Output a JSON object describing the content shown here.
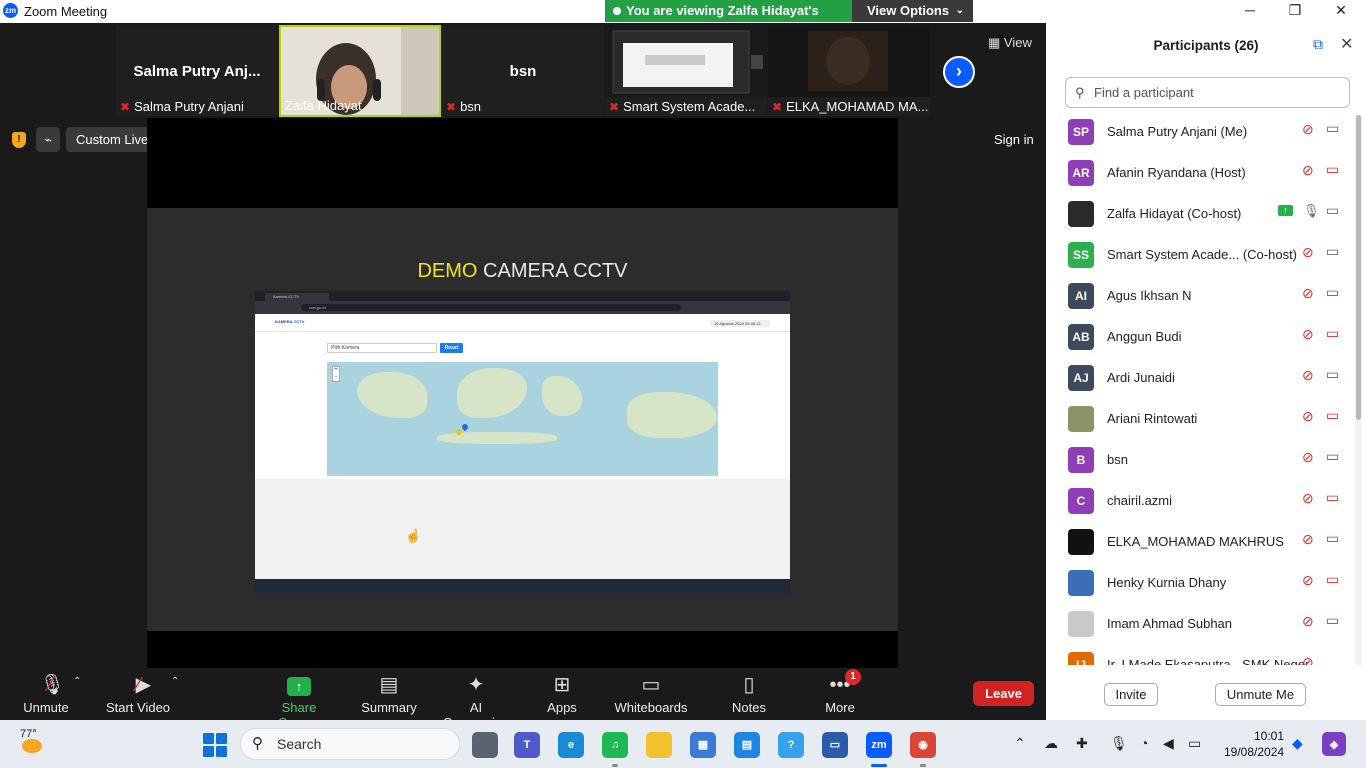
{
  "window": {
    "app_title": "Zoom Meeting",
    "logo": "zm",
    "minimize": "─",
    "maximize": "❐",
    "close": "✕"
  },
  "share_banner": {
    "text": "You are viewing Zalfa Hidayat's screen",
    "view_options": "View Options",
    "caret": "⌄"
  },
  "gallery": {
    "tiles": [
      {
        "big_name": "Salma Putry Anj...",
        "label": "Salma Putry Anjani",
        "muted": true
      },
      {
        "big_name": "",
        "label": "Zalfa Hidayat",
        "muted": false
      },
      {
        "big_name": "bsn",
        "label": "bsn",
        "muted": true
      },
      {
        "big_name": "",
        "label": "Smart System Acade...",
        "muted": true
      },
      {
        "big_name": "",
        "label": "ELKA_MOHAMAD MA...",
        "muted": true
      }
    ],
    "next_glyph": "›",
    "view_label": "View"
  },
  "stream": {
    "service": "Custom Live Streaming Service",
    "stream_glyph": "⌁",
    "shield_glyph": "!",
    "sign_in": "Sign in"
  },
  "shared_screen": {
    "title_highlight": "DEMO",
    "title_rest": "CAMERA CCTV",
    "browser_tab": "Kamera CCTV",
    "browser_url": "cctv.go.id",
    "site_brand": "KAMERA CCTV",
    "site_date": "19 Agustus 2024 09.48.12",
    "select_placeholder": "Pilih Kamera",
    "reset_label": "Reset",
    "zoom_in": "+",
    "zoom_out": "-"
  },
  "toolbar": {
    "unmute": "Unmute",
    "start_video": "Start Video",
    "share_screen": "Share Screen",
    "summary": "Summary",
    "ai_companion": "AI Companion",
    "apps": "Apps",
    "whiteboards": "Whiteboards",
    "notes": "Notes",
    "more": "More",
    "more_badge": "1",
    "leave": "Leave",
    "caret": "⌃"
  },
  "participants": {
    "title": "Participants (26)",
    "search_placeholder": "Find a participant",
    "invite": "Invite",
    "unmute_me": "Unmute Me",
    "list": [
      {
        "initials": "SP",
        "name": "Salma Putry Anjani (Me)",
        "color": "#8e3fb5",
        "mic": "off",
        "cam": "off"
      },
      {
        "initials": "AR",
        "name": "Afanin Ryandana (Host)",
        "color": "#8e3fb5",
        "mic": "off",
        "cam": "off"
      },
      {
        "initials": "",
        "name": "Zalfa Hidayat (Co-host)",
        "color": "#2b2b2b",
        "mic": "on",
        "cam": "ok",
        "sharing": true
      },
      {
        "initials": "SS",
        "name": "Smart System Acade...  (Co-host)",
        "color": "#2fae4f",
        "mic": "off",
        "cam": "ok"
      },
      {
        "initials": "AI",
        "name": "Agus Ikhsan N",
        "color": "#3d4a5c",
        "mic": "off",
        "cam": "off"
      },
      {
        "initials": "AB",
        "name": "Anggun Budi",
        "color": "#3d4a5c",
        "mic": "off",
        "cam": "off"
      },
      {
        "initials": "AJ",
        "name": "Ardi Junaidi",
        "color": "#3d4a5c",
        "mic": "off",
        "cam": "off"
      },
      {
        "initials": "",
        "name": "Ariani Rintowati",
        "color": "#8a9468",
        "mic": "off",
        "cam": "off"
      },
      {
        "initials": "B",
        "name": "bsn",
        "color": "#8e3fb5",
        "mic": "off",
        "cam": "off"
      },
      {
        "initials": "C",
        "name": "chairil.azmi",
        "color": "#8e3fb5",
        "mic": "off",
        "cam": "off"
      },
      {
        "initials": "",
        "name": "ELKA_MOHAMAD MAKHRUS",
        "color": "#111111",
        "mic": "off",
        "cam": "off"
      },
      {
        "initials": "",
        "name": "Henky Kurnia Dhany",
        "color": "#3b6fb5",
        "mic": "off",
        "cam": "off"
      },
      {
        "initials": "",
        "name": "Imam Ahmad Subhan",
        "color": "#c9c9c9",
        "mic": "off",
        "cam": "off"
      },
      {
        "initials": "IJ",
        "name": "Ir. I Made Ekasaputra - SMK Neger...",
        "color": "#e36a00",
        "mic": "off",
        "cam": "none"
      }
    ],
    "mic_off_glyph": "⊘",
    "mic_on_glyph": "🎙",
    "cam_glyph": "▭",
    "popout_glyph": "⧉",
    "close_glyph": "✕",
    "search_glyph": "⚲"
  },
  "taskbar": {
    "weather": "77°",
    "search": "Search",
    "search_glyph": "⚲",
    "time": "10:01",
    "date": "19/08/2024",
    "apps": [
      {
        "name": "task-view",
        "label": "",
        "color": "#5a6470"
      },
      {
        "name": "teams",
        "label": "T",
        "color": "#5059c9"
      },
      {
        "name": "edge",
        "label": "e",
        "color": "#1b8ad6"
      },
      {
        "name": "spotify",
        "label": "♫",
        "color": "#1db954"
      },
      {
        "name": "file-explorer",
        "label": "",
        "color": "#f2c12e"
      },
      {
        "name": "calculator",
        "label": "▦",
        "color": "#3a7bd5"
      },
      {
        "name": "store",
        "label": "▤",
        "color": "#1e86e0"
      },
      {
        "name": "help",
        "label": "?",
        "color": "#36a2eb"
      },
      {
        "name": "reader",
        "label": "▭",
        "color": "#2a5caa"
      },
      {
        "name": "zoom",
        "label": "zm",
        "color": "#0b5cff"
      },
      {
        "name": "chrome",
        "label": "◉",
        "color": "#db4437"
      }
    ],
    "tray": {
      "up": "⌃",
      "wifi": "◔",
      "sound": "◀",
      "battery": "▭",
      "bell": "◆"
    }
  }
}
